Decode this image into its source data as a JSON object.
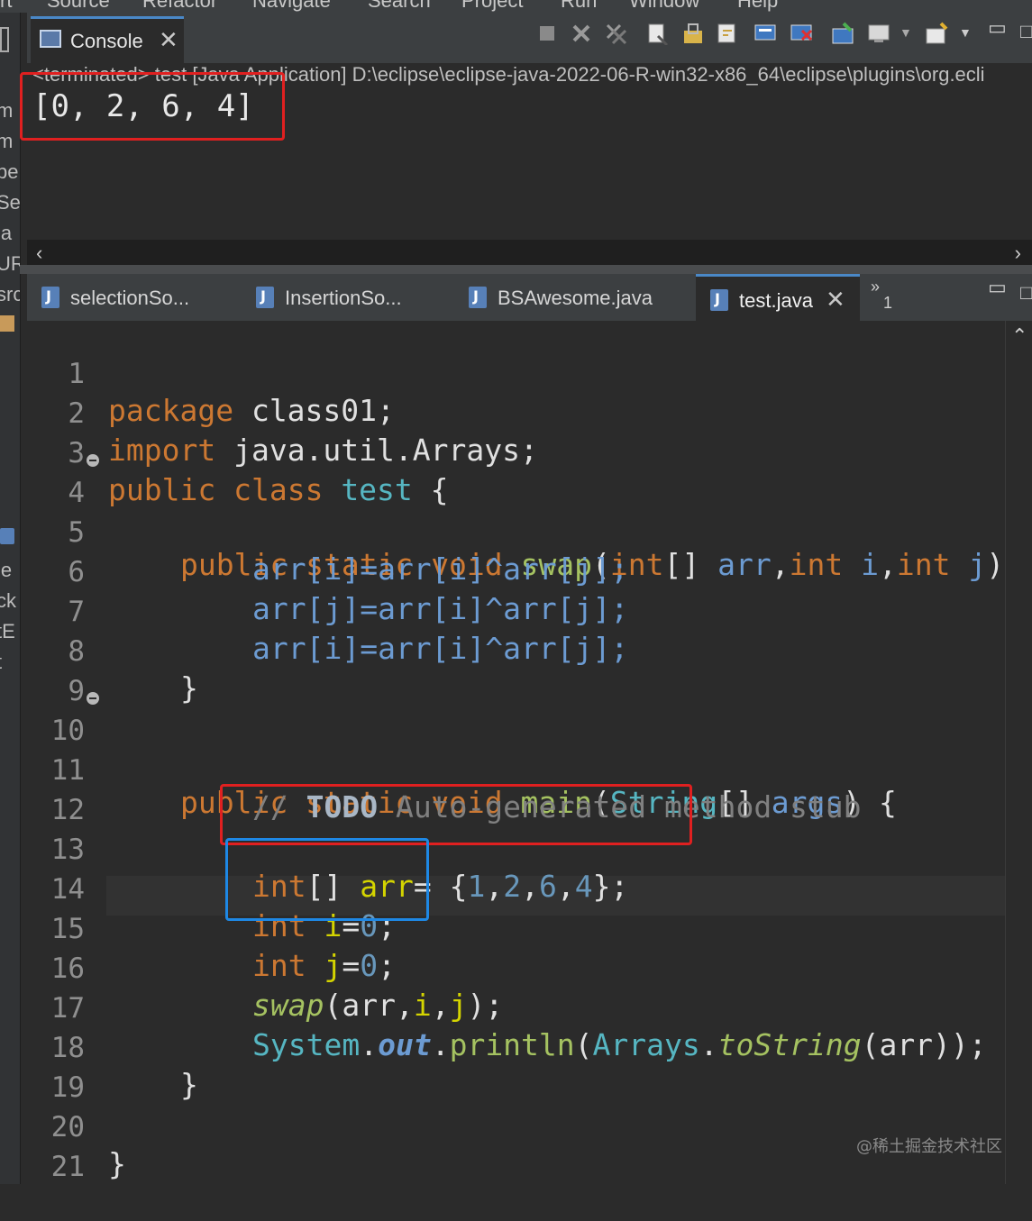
{
  "menu": {
    "items": [
      "rt",
      "Source",
      "Refactor",
      "Navigate",
      "Search",
      "Project",
      "Run",
      "Window",
      "Help"
    ]
  },
  "left_strip": {
    "fragments": [
      "m",
      "m",
      "per",
      "Se",
      "ja",
      "UR",
      "src",
      "je",
      "ck",
      "tE",
      "t"
    ]
  },
  "console": {
    "tab_label": "Console",
    "terminated_line": "<terminated> test [Java Application] D:\\eclipse\\eclipse-java-2022-06-R-win32-x86_64\\eclipse\\plugins\\org.ecli",
    "output": "[0, 2, 6, 4]"
  },
  "editor_tabs": [
    {
      "label": "selectionSo..."
    },
    {
      "label": "InsertionSo..."
    },
    {
      "label": "BSAwesome.java"
    },
    {
      "label": "test.java",
      "active": true
    }
  ],
  "overflow_count": "1",
  "code": {
    "line_numbers": [
      "1",
      "2",
      "3",
      "4",
      "5",
      "6",
      "7",
      "8",
      "9",
      "10",
      "11",
      "12",
      "13",
      "14",
      "15",
      "16",
      "17",
      "18",
      "19",
      "20",
      "21"
    ],
    "l1": {
      "kw": "package",
      "rest": " class01;"
    },
    "l2": {
      "kw": "import",
      "rest": " java.util.Arrays;"
    },
    "l3": {
      "kw1": "public",
      "kw2": "class",
      "name": "test",
      "rest": " {"
    },
    "l4": {
      "kw1": "public",
      "kw2": "static",
      "kw3": "void",
      "fn": "swap",
      "p1": "(",
      "t1": "int",
      "p2": "[] ",
      "a1": "arr",
      "p3": ",",
      "t2": "int",
      "a2": " i",
      "p4": ",",
      "t3": "int",
      "a3": " j",
      "p5": ")"
    },
    "l5": "arr[i]=arr[i]^arr[j];",
    "l6": "arr[j]=arr[i]^arr[j];",
    "l7": "arr[i]=arr[i]^arr[j];",
    "l8": "}",
    "l10": {
      "kw1": "public",
      "kw2": "static",
      "kw3": "void",
      "fn": "main",
      "p1": "(",
      "cls": "String",
      "p2": "[] ",
      "arg": "args",
      "p3": ") {"
    },
    "l11": {
      "slash": "// ",
      "todo": "TODO",
      "rest": " Auto-generated method stub"
    },
    "l13": {
      "t": "int",
      "p1": "[] ",
      "v": "arr",
      "p2": "= {",
      "n1": "1",
      "c1": ",",
      "n2": "2",
      "c2": ",",
      "n3": "6",
      "c3": ",",
      "n4": "4",
      "p3": "};"
    },
    "l14": {
      "t": "int",
      "v": " i",
      "eq": "=",
      "n": "0",
      "end": ";"
    },
    "l15": {
      "t": "int",
      "v": " j",
      "eq": "=",
      "n": "0",
      "end": ";"
    },
    "l16": {
      "fn": "swap",
      "p1": "(arr,",
      "v1": "i",
      "c": ",",
      "v2": "j",
      "p2": ");"
    },
    "l17": {
      "cls": "System",
      "dot1": ".",
      "fld": "out",
      "dot2": ".",
      "fn": "println",
      "p1": "(",
      "cls2": "Arrays",
      "dot3": ".",
      "st": "toString",
      "p2": "(arr));"
    },
    "l18": "}",
    "l20": "}"
  },
  "watermark": "@稀土掘金技术社区",
  "colors": {
    "annotation_red": "#e02020",
    "annotation_blue": "#1e88e5",
    "background": "#2b2b2b"
  }
}
